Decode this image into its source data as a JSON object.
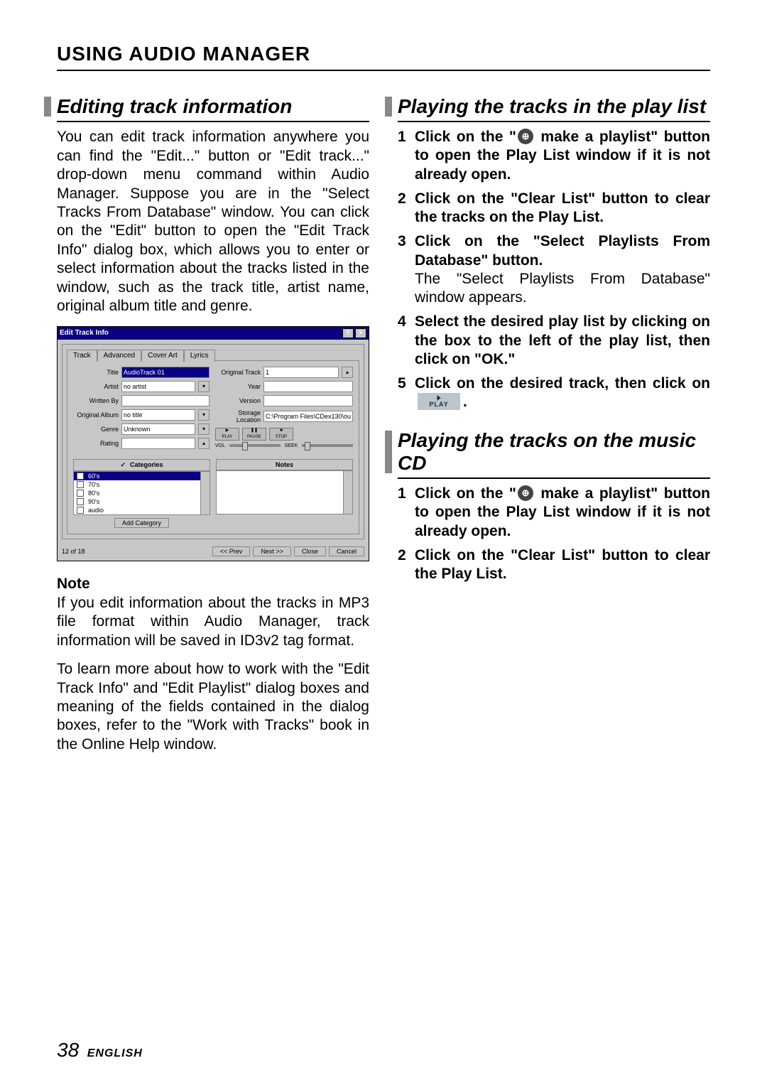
{
  "header": "USING AUDIO MANAGER",
  "left": {
    "heading": "Editing track information",
    "para1": "You can edit track information anywhere you can find the \"Edit...\" button or \"Edit track...\" drop-down menu command within Audio Manager. Suppose you are in the \"Select Tracks From Database\" window. You can click on the \"Edit\" button to open the \"Edit Track Info\" dialog box, which allows you to enter or select information about the tracks listed in the window, such as the track title, artist name, original album title and genre.",
    "note_title": "Note",
    "note_para1": "If you edit information about the tracks in MP3 file format within Audio Manager, track information will be saved in ID3v2 tag format.",
    "note_para2": "To learn more about how to work with the \"Edit Track Info\" and \"Edit Playlist\" dialog boxes and meaning of the fields contained in the dialog boxes, refer to the \"Work with Tracks\" book in the Online Help window."
  },
  "dialog": {
    "title": "Edit Track Info",
    "tabs": [
      "Track",
      "Advanced",
      "Cover Art",
      "Lyrics"
    ],
    "fields": {
      "title_label": "Title",
      "title_value": "AudioTrack 01",
      "artist_label": "Artist",
      "artist_value": "no artist",
      "written_label": "Written By",
      "written_value": "",
      "origalbum_label": "Original Album",
      "origalbum_value": "no title",
      "genre_label": "Genre",
      "genre_value": "Unknown",
      "rating_label": "Rating",
      "origtrack_label": "Original Track",
      "origtrack_value": "1",
      "year_label": "Year",
      "version_label": "Version",
      "storage_label": "Storage Location",
      "storage_value": "C:\\Program Files\\CDex130\\ou"
    },
    "transport": {
      "play": "PLAY",
      "pause": "PAUSE",
      "stop": "STOP"
    },
    "sliders": {
      "vol": "VOL",
      "seek": "SEEK"
    },
    "categories_label": "Categories",
    "categories": [
      "60's",
      "70's",
      "80's",
      "90's",
      "audio"
    ],
    "notes_label": "Notes",
    "add_category": "Add Category",
    "position": "12 of 18",
    "buttons": {
      "prev": "<< Prev",
      "next": "Next >>",
      "close": "Close",
      "cancel": "Cancel"
    }
  },
  "right": {
    "heading1": "Playing the tracks in the play list",
    "steps1": [
      {
        "bold_a": "Click on the \"",
        "bold_b": " make a playlist\" button to open the Play List window if it is not already open."
      },
      {
        "bold": "Click on the \"Clear List\" button to clear the tracks on the Play List."
      },
      {
        "bold": "Click on the \"Select Playlists From Database\" button.",
        "normal": "The \"Select Playlists From Database\" window appears."
      },
      {
        "bold": "Select the desired play list by clicking on the box to the left of the play list, then click on \"OK.\""
      },
      {
        "bold_a": "Click on the desired track, then click on ",
        "bold_b": "."
      }
    ],
    "heading2": "Playing the tracks on the music CD",
    "steps2": [
      {
        "bold_a": "Click on the \"",
        "bold_b": " make a playlist\" button to open the Play List window if it is not already open."
      },
      {
        "bold": "Click on the \"Clear List\" button to clear the Play List."
      }
    ],
    "play_label": "PLAY"
  },
  "footer": {
    "page": "38",
    "lang": "ENGLISH"
  }
}
